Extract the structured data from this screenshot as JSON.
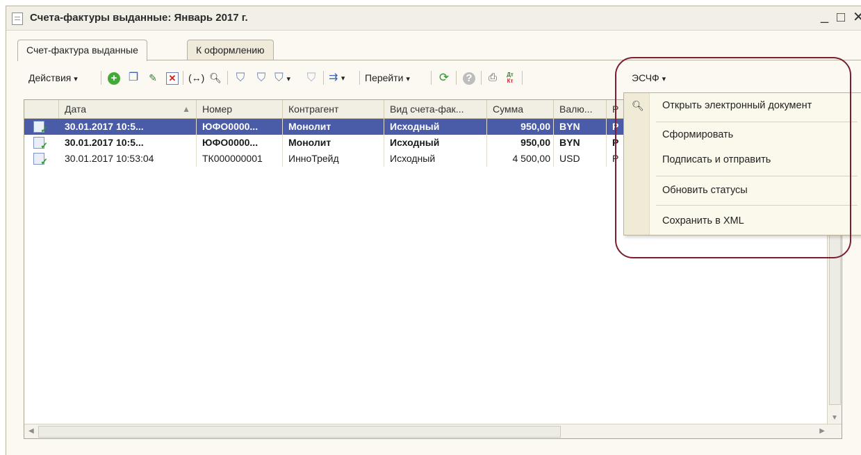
{
  "window": {
    "title": "Счета-фактуры выданные: Январь 2017 г.",
    "controls": {
      "minimize": "_",
      "maximize": "□",
      "close": "✕"
    }
  },
  "tabs": [
    {
      "label": "Счет-фактура выданные",
      "active": true
    },
    {
      "label": "К оформлению",
      "active": false
    }
  ],
  "toolbar": {
    "actions_label": "Действия",
    "goto_label": "Перейти",
    "escf_label": "ЭСЧФ",
    "dropdown_arrow": "▾",
    "dtkt_top": "Дт",
    "dtkt_bottom": "Кт",
    "icons": [
      "add-icon",
      "copy-icon",
      "edit-icon",
      "delete-icon",
      "swap-icon",
      "search-icon",
      "filter-icon",
      "filter-select-icon",
      "filter-list-icon",
      "filter-clear-icon",
      "structure-icon",
      "refresh-icon",
      "help-icon",
      "print-icon",
      "dt-kt-icon"
    ]
  },
  "table": {
    "headers": [
      "Дата",
      "Номер",
      "Контрагент",
      "Вид счета-фак...",
      "Сумма",
      "Валю...",
      "Р"
    ],
    "rows": [
      {
        "date": "30.01.2017 10:5...",
        "number": "ЮФО0000...",
        "counterparty": "Монолит",
        "type": "Исходный",
        "amount": "950,00",
        "currency": "BYN",
        "extra": "Р",
        "bold": true,
        "selected": true
      },
      {
        "date": "30.01.2017 10:5...",
        "number": "ЮФО0000...",
        "counterparty": "Монолит",
        "type": "Исходный",
        "amount": "950,00",
        "currency": "BYN",
        "extra": "Р",
        "bold": true,
        "selected": false
      },
      {
        "date": "30.01.2017 10:53:04",
        "number": "ТК000000001",
        "counterparty": "ИнноТрейд",
        "type": "Исходный",
        "amount": "4 500,00",
        "currency": "USD",
        "extra": "Р",
        "bold": false,
        "selected": false
      }
    ]
  },
  "menu": {
    "items": [
      "Открыть электронный документ",
      "Сформировать",
      "Подписать и отправить",
      "Обновить статусы",
      "Сохранить в XML"
    ]
  },
  "colors": {
    "selection": "#4a5ca8",
    "highlight_ring": "#7d1d2e",
    "window_bg": "#fbf9f1"
  }
}
